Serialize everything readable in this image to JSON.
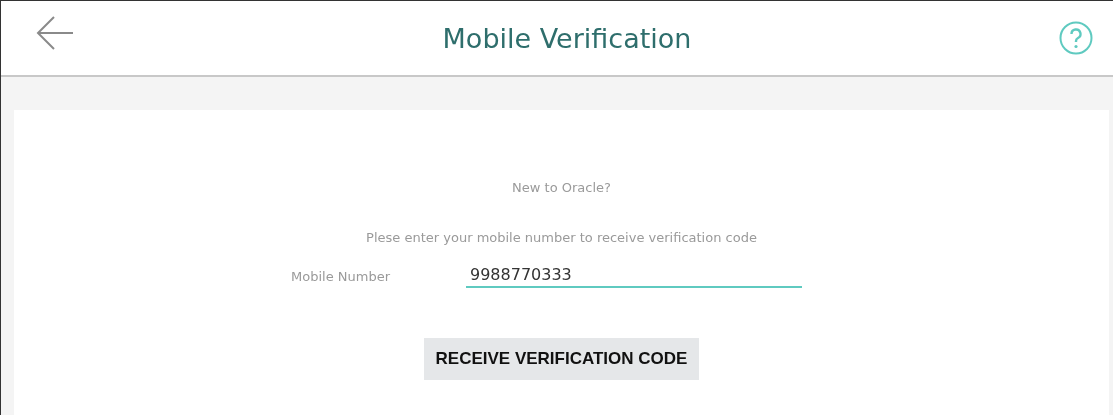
{
  "header": {
    "title": "Mobile Verification"
  },
  "form": {
    "intro": "New to Oracle?",
    "instruction": "Plese enter your mobile number to receive verification code",
    "mobile_field": {
      "label": "Mobile Number",
      "value": "9988770333"
    },
    "submit_button": "RECEIVE VERIFICATION CODE"
  }
}
